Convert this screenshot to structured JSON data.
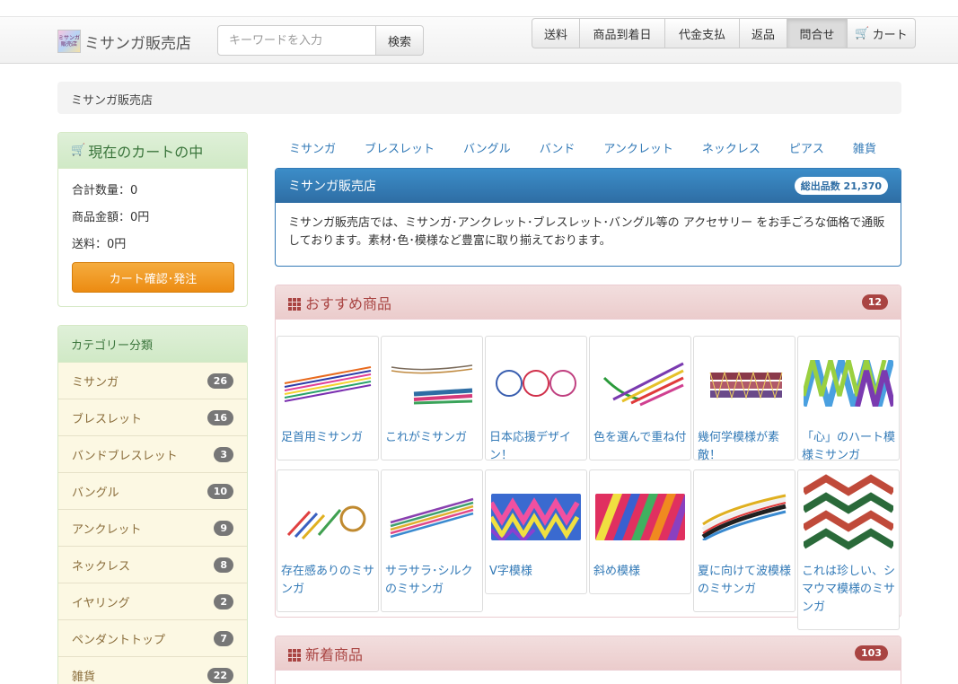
{
  "navbar": {
    "brand_name": "ミサンガ販売店",
    "logo_text": "ミサンガ 販売店",
    "search_placeholder": "キーワードを入力",
    "search_button": "検索",
    "nav_items": [
      {
        "label": "送料"
      },
      {
        "label": "商品到着日"
      },
      {
        "label": "代金支払"
      },
      {
        "label": "返品"
      },
      {
        "label": "問合せ",
        "active": true
      },
      {
        "label": "カート",
        "icon": "cart-icon"
      }
    ]
  },
  "breadcrumb": "ミサンガ販売店",
  "cart": {
    "title": "現在のカートの中",
    "quantity": "合計数量：0",
    "amount": "商品金額：0円",
    "shipping": "送料：0円",
    "order_button": "カート確認･発注"
  },
  "categories": {
    "title": "カテゴリー分類",
    "items": [
      {
        "label": "ミサンガ",
        "count": "26"
      },
      {
        "label": "ブレスレット",
        "count": "16"
      },
      {
        "label": "バンドブレスレット",
        "count": "3"
      },
      {
        "label": "バングル",
        "count": "10"
      },
      {
        "label": "アンクレット",
        "count": "9"
      },
      {
        "label": "ネックレス",
        "count": "8"
      },
      {
        "label": "イヤリング",
        "count": "2"
      },
      {
        "label": "ペンダントトップ",
        "count": "7"
      },
      {
        "label": "雑貨",
        "count": "22"
      }
    ]
  },
  "catnav": [
    "ミサンガ",
    "ブレスレット",
    "バングル",
    "バンド",
    "アンクレット",
    "ネックレス",
    "ピアス",
    "雑貨"
  ],
  "info": {
    "title": "ミサンガ販売店",
    "badge": "総出品数 21,370",
    "body": "ミサンガ販売店では、ミサンガ･アンクレット･ブレスレット･バングル等の アクセサリー をお手ごろな価格で通販しております。素材･色･模様など豊富に取り揃えております。"
  },
  "recommended": {
    "title": "おすすめ商品",
    "count": "12",
    "items": [
      {
        "name": "足首用ミサンガ"
      },
      {
        "name": "これがミサンガ"
      },
      {
        "name": "日本応援デザイン！"
      },
      {
        "name": "色を選んで重ね付"
      },
      {
        "name": "幾何学模様が素敵！"
      },
      {
        "name": "「心」のハート模様ミサンガ"
      },
      {
        "name": "存在感ありのミサンガ"
      },
      {
        "name": "サラサラ･シルクのミサンガ"
      },
      {
        "name": "V字模様"
      },
      {
        "name": "斜め模様"
      },
      {
        "name": "夏に向けて波模様のミサンガ"
      },
      {
        "name": "これは珍しい、シマウマ模様のミサンガ"
      }
    ]
  },
  "new_items": {
    "title": "新着商品",
    "count": "103"
  },
  "colors": {
    "link": "#337ab7",
    "primary": "#2e6da4",
    "danger": "#a94442",
    "success_bg": "#dff0d8",
    "warning_bg": "#fcf8e3",
    "orange_btn": "#ec8b12"
  }
}
